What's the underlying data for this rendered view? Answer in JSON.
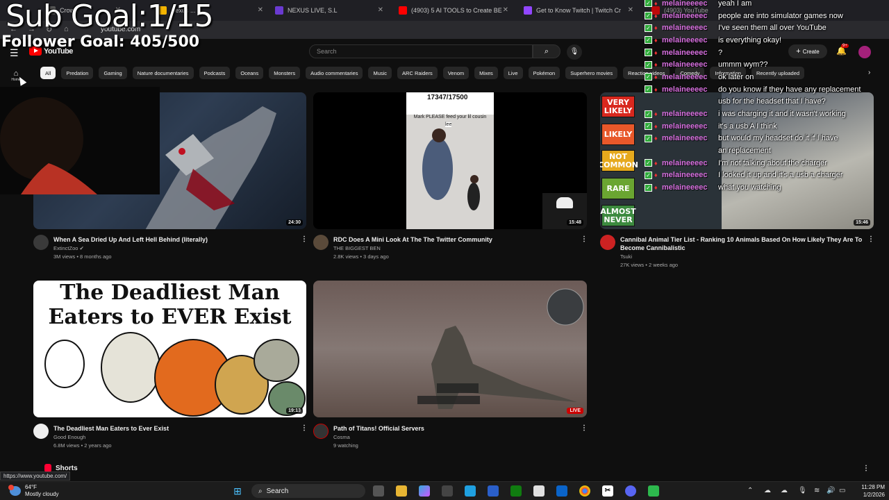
{
  "browser": {
    "tabs": [
      {
        "label": "Crown",
        "color": "#555"
      },
      {
        "label": "Nexus ...",
        "color": "#f4b400"
      },
      {
        "label": "NEXUS LIVE, S.L",
        "color": "#6a3ad1"
      },
      {
        "label": "(4903) 5 AI TOOLS to Create BE",
        "color": "#ff0000"
      },
      {
        "label": "Get to Know Twitch | Twitch Cr",
        "color": "#9146ff"
      },
      {
        "label": "(4903) YouTube",
        "color": "#ff0000"
      }
    ],
    "url": "youtube.com",
    "status_url": "https://www.youtube.com/"
  },
  "overlay": {
    "sub_goal": "Sub Goal:1/15",
    "follower_goal": "Follower Goal: 405/500"
  },
  "youtube": {
    "logo_text": "YouTube",
    "search_placeholder": "Search",
    "create_label": "Create",
    "notif_count": "9+",
    "home_label": "Home",
    "chips": [
      "All",
      "Predation",
      "Gaming",
      "Nature documentaries",
      "Podcasts",
      "Oceans",
      "Monsters",
      "Audio commentaries",
      "Music",
      "ARC Raiders",
      "Venom",
      "Mixes",
      "Live",
      "Pokémon",
      "Superhero movies",
      "Reaction videos",
      "Comedy",
      "Information",
      "Recently uploaded"
    ],
    "videos": [
      {
        "title": "When A Sea Dried Up And Left Hell Behind (literally)",
        "channel": "ExtinctZoo",
        "meta": "3M views • 8 months ago",
        "duration": "24:30"
      },
      {
        "title": "RDC Does A Mini Look At The The Twitter Community",
        "channel": "THE BIGGEST BEN",
        "meta": "2.8K views • 3 days ago",
        "duration": "15:48",
        "overlay_counter": "17347/17500",
        "overlay_caption": "Mark PLEASE feed your lil cousin",
        "overlay_name": "lee"
      },
      {
        "title": "Cannibal Animal Tier List - Ranking 10 Animals Based On How Likely They Are To Become Cannibalistic",
        "channel": "Tsuki",
        "meta": "27K views • 2 weeks ago",
        "duration": "15:46",
        "tiers": [
          "VERY LIKELY",
          "LIKELY",
          "NOT COMMON",
          "RARE",
          "ALMOST NEVER"
        ]
      },
      {
        "title": "The Deadliest Man Eaters to Ever Exist",
        "channel": "Good Enough",
        "meta": "6.8M views • 2 years ago",
        "duration": "19:13",
        "thumb_text": "The Deadliest Man Eaters to EVER Exist"
      },
      {
        "title": "Path of Titans! Official Servers",
        "channel": "Cosma",
        "meta": "9 watching",
        "live": "LIVE"
      }
    ],
    "shorts_label": "Shorts"
  },
  "chat": [
    {
      "user": "melaineeeec",
      "msg": "yeah I am"
    },
    {
      "user": "melaineeeec",
      "msg": "people are into simulator games now"
    },
    {
      "user": "melaineeeec",
      "msg": "I've seen them all over YouTube"
    },
    {
      "user": "melaineeeec",
      "msg": "is everything okay!"
    },
    {
      "user": "melaineeeec",
      "msg": "?"
    },
    {
      "user": "melaineeeec",
      "msg": "ummm wym??"
    },
    {
      "user": "melaineeeec",
      "msg": "ok later on"
    },
    {
      "user": "melaineeeec",
      "msg": "do you know if they have any replacement"
    },
    {
      "user": "",
      "msg": "usb for the headset that I have?"
    },
    {
      "user": "melaineeeec",
      "msg": "i was charging it and it wasn't working"
    },
    {
      "user": "melaineeeec",
      "msg": "it's a usb A I think"
    },
    {
      "user": "melaineeeec",
      "msg": "but would my headset do it if I have"
    },
    {
      "user": "",
      "msg": "an replacement"
    },
    {
      "user": "melaineeeec",
      "msg": "I'm not talking about the charger"
    },
    {
      "user": "melaineeeec",
      "msg": "I looked it up and it's a usb a charger"
    },
    {
      "user": "melaineeeec",
      "msg": "what you watching"
    }
  ],
  "taskbar": {
    "temp": "64°F",
    "weather": "Mostly cloudy",
    "search_label": "Search",
    "time": "11:28 PM",
    "date": "1/2/2026"
  },
  "colors": {
    "accent": "#ff0000",
    "chat_user": "#d870e0",
    "live": "#cc0000"
  }
}
